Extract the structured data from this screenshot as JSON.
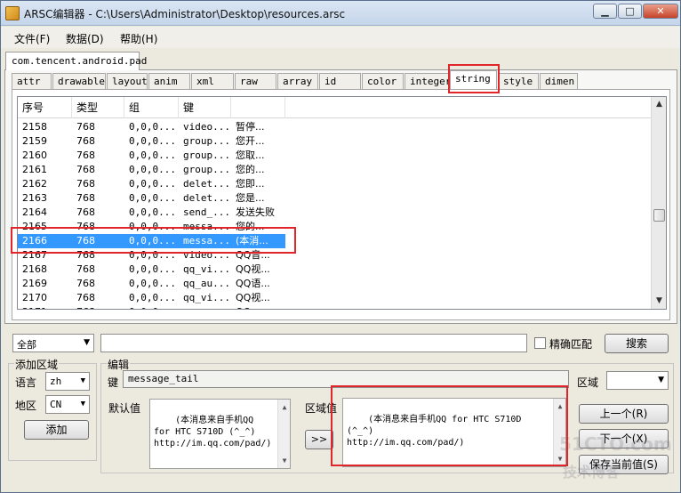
{
  "window": {
    "title": "ARSC编辑器 - C:\\Users\\Administrator\\Desktop\\resources.arsc",
    "minimize": "▁",
    "maximize": "□",
    "close": "✕"
  },
  "menu": [
    "文件(F)",
    "数据(D)",
    "帮助(H)"
  ],
  "package_tab": "com.tencent.android.pad",
  "resource_tabs": [
    "attr",
    "drawable",
    "layout",
    "anim",
    "xml",
    "raw",
    "array",
    "id",
    "color",
    "integer",
    "string",
    "style",
    "dimen"
  ],
  "active_tab": "string",
  "table": {
    "headers": [
      "序号",
      "类型",
      "组",
      "键",
      ""
    ],
    "rows": [
      [
        "2158",
        "768",
        "0,0,0...",
        "video...",
        "暂停..."
      ],
      [
        "2159",
        "768",
        "0,0,0...",
        "group...",
        "您开..."
      ],
      [
        "2160",
        "768",
        "0,0,0...",
        "group...",
        "您取..."
      ],
      [
        "2161",
        "768",
        "0,0,0...",
        "group...",
        "您的..."
      ],
      [
        "2162",
        "768",
        "0,0,0...",
        "delet...",
        "您即..."
      ],
      [
        "2163",
        "768",
        "0,0,0...",
        "delet...",
        "您是..."
      ],
      [
        "2164",
        "768",
        "0,0,0...",
        "send_...",
        "发送失败"
      ],
      [
        "2165",
        "768",
        "0,0,0...",
        "messa...",
        "您的..."
      ],
      [
        "2166",
        "768",
        "0,0,0...",
        "messa...",
        "(本消..."
      ],
      [
        "2167",
        "768",
        "0,0,0...",
        "video...",
        "QQ音..."
      ],
      [
        "2168",
        "768",
        "0,0,0...",
        "qq_vi...",
        "QQ视..."
      ],
      [
        "2169",
        "768",
        "0,0,0...",
        "qq_au...",
        "QQ语..."
      ],
      [
        "2170",
        "768",
        "0,0,0...",
        "qq_vi...",
        "QQ视..."
      ],
      [
        "2171",
        "768",
        "0,0,0...",
        "qq_...",
        "QQ..."
      ]
    ],
    "selected_index": 8
  },
  "search": {
    "scope": "全部",
    "query": "",
    "exact_match_label": "精确匹配",
    "button": "搜索"
  },
  "add_region": {
    "title": "添加区域",
    "language_label": "语言",
    "language_value": "zh",
    "region_label": "地区",
    "region_value": "CN",
    "add_button": "添加"
  },
  "edit": {
    "title": "编辑",
    "key_label": "键",
    "key_value": "message_tail",
    "default_label": "默认值",
    "default_value": "(本消息来自手机QQ for HTC S710D (^_^)\nhttp://im.qq.com/pad/)",
    "copy_button": ">>",
    "region_value_label": "区域值",
    "region_value": "(本消息来自手机QQ for HTC S710D (^_^)\nhttp://im.qq.com/pad/)",
    "region_label": "区域",
    "region_select": "",
    "prev_button": "上一个(R)",
    "next_button": "下一个(X)",
    "save_button": "保存当前值(S)"
  },
  "watermark": [
    "51CTO.com",
    "技术博客"
  ],
  "colors": {
    "selection": "#3399ff",
    "annotation": "#e0252b"
  }
}
